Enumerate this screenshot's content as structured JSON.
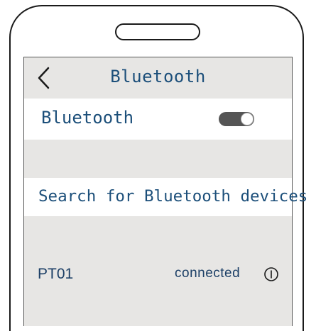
{
  "header": {
    "back_icon": "chevron-left-icon",
    "title": "Bluetooth"
  },
  "bluetooth_toggle": {
    "label": "Bluetooth",
    "state": "on"
  },
  "search": {
    "label": "Search for Bluetooth devices"
  },
  "devices": [
    {
      "name": "PT01",
      "status": "connected",
      "icon": "info-icon"
    }
  ],
  "colors": {
    "text": "#1c4f7a",
    "screen_bg": "#e7e6e4",
    "row_bg": "#ffffff",
    "toggle_track": "#555555"
  }
}
